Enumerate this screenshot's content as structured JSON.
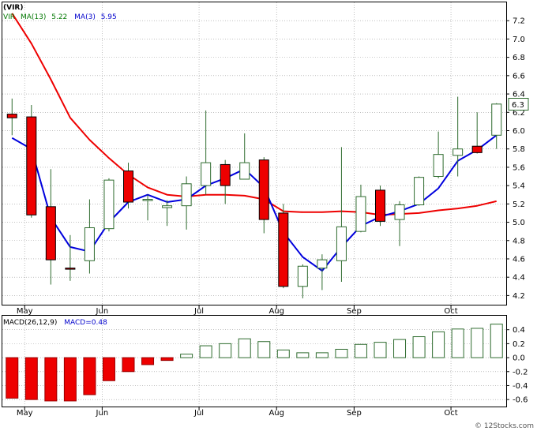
{
  "title": "(VIR)",
  "watermark": "© 12Stocks.com",
  "chart_data": [
    {
      "type": "candlestick",
      "legend": {
        "symbol": "VIR",
        "ma13_label": "MA(13)",
        "ma13_value": "5.22",
        "ma3_label": "MA(3)",
        "ma3_value": "5.95"
      },
      "y_ticks": [
        "4.2",
        "4.4",
        "4.6",
        "4.8",
        "5.0",
        "5.2",
        "5.4",
        "5.6",
        "5.8",
        "6.0",
        "6.2",
        "6.4",
        "6.6",
        "6.8",
        "7.0",
        "7.2"
      ],
      "ylim": [
        4.1,
        7.4
      ],
      "months": [
        "May",
        "Jun",
        "Jul",
        "Aug",
        "Sep",
        "Oct"
      ],
      "month_index": [
        1,
        5,
        10,
        14,
        18,
        23
      ],
      "last_price": "6.3",
      "candles": [
        {
          "o": 6.18,
          "h": 6.35,
          "l": 5.95,
          "c": 6.14
        },
        {
          "o": 6.15,
          "h": 6.28,
          "l": 5.05,
          "c": 5.08
        },
        {
          "o": 5.17,
          "h": 5.58,
          "l": 4.32,
          "c": 4.59
        },
        {
          "o": 4.5,
          "h": 4.86,
          "l": 4.36,
          "c": 4.49
        },
        {
          "o": 4.58,
          "h": 5.25,
          "l": 4.44,
          "c": 4.94
        },
        {
          "o": 4.93,
          "h": 5.48,
          "l": 4.9,
          "c": 5.46
        },
        {
          "o": 5.56,
          "h": 5.65,
          "l": 5.15,
          "c": 5.22
        },
        {
          "o": 5.24,
          "h": 5.3,
          "l": 5.02,
          "c": 5.25
        },
        {
          "o": 5.16,
          "h": 5.24,
          "l": 4.96,
          "c": 5.18
        },
        {
          "o": 5.18,
          "h": 5.5,
          "l": 4.92,
          "c": 5.42
        },
        {
          "o": 5.4,
          "h": 6.22,
          "l": 5.3,
          "c": 5.65
        },
        {
          "o": 5.63,
          "h": 5.68,
          "l": 5.2,
          "c": 5.4
        },
        {
          "o": 5.47,
          "h": 5.97,
          "l": 5.47,
          "c": 5.65
        },
        {
          "o": 5.68,
          "h": 5.71,
          "l": 4.88,
          "c": 5.03
        },
        {
          "o": 5.1,
          "h": 5.2,
          "l": 4.28,
          "c": 4.3
        },
        {
          "o": 4.3,
          "h": 4.54,
          "l": 4.17,
          "c": 4.52
        },
        {
          "o": 4.5,
          "h": 4.65,
          "l": 4.26,
          "c": 4.59
        },
        {
          "o": 4.58,
          "h": 5.82,
          "l": 4.35,
          "c": 4.95
        },
        {
          "o": 4.9,
          "h": 5.41,
          "l": 4.89,
          "c": 5.28
        },
        {
          "o": 5.35,
          "h": 5.4,
          "l": 4.96,
          "c": 5.01
        },
        {
          "o": 5.03,
          "h": 5.23,
          "l": 4.74,
          "c": 5.19
        },
        {
          "o": 5.19,
          "h": 5.5,
          "l": 5.18,
          "c": 5.49
        },
        {
          "o": 5.5,
          "h": 5.99,
          "l": 5.48,
          "c": 5.74
        },
        {
          "o": 5.73,
          "h": 6.37,
          "l": 5.5,
          "c": 5.8
        },
        {
          "o": 5.83,
          "h": 6.2,
          "l": 5.75,
          "c": 5.76
        },
        {
          "o": 5.95,
          "h": 6.3,
          "l": 5.8,
          "c": 6.29
        }
      ],
      "ma13": [
        7.28,
        6.95,
        6.56,
        6.14,
        5.9,
        5.7,
        5.52,
        5.38,
        5.3,
        5.28,
        5.3,
        5.3,
        5.29,
        5.25,
        5.12,
        5.11,
        5.11,
        5.12,
        5.11,
        5.08,
        5.09,
        5.1,
        5.13,
        5.15,
        5.18,
        5.23
      ],
      "ma3": [
        5.92,
        5.8,
        5.05,
        4.73,
        4.68,
        5.0,
        5.22,
        5.3,
        5.22,
        5.25,
        5.4,
        5.48,
        5.58,
        5.38,
        4.89,
        4.62,
        4.47,
        4.73,
        4.96,
        5.06,
        5.12,
        5.2,
        5.37,
        5.67,
        5.79,
        5.95
      ]
    },
    {
      "type": "bar",
      "legend": {
        "label": "MACD(26,12,9)",
        "value_label": "MACD=0.48"
      },
      "y_ticks": [
        "0.4",
        "0.2",
        "0.0",
        "-0.2",
        "-0.4",
        "-0.6"
      ],
      "ylim": [
        -0.7,
        0.6
      ],
      "values": [
        -0.58,
        -0.6,
        -0.62,
        -0.62,
        -0.53,
        -0.33,
        -0.2,
        -0.1,
        -0.04,
        0.05,
        0.17,
        0.2,
        0.27,
        0.23,
        0.11,
        0.07,
        0.07,
        0.12,
        0.19,
        0.22,
        0.26,
        0.3,
        0.37,
        0.41,
        0.42,
        0.48
      ],
      "colors": {
        "positive": "#2e6b2e",
        "negative": "#ee0000"
      }
    }
  ],
  "colors": {
    "bull_stroke": "#2e6b2e",
    "bear_fill": "#ee0000",
    "ma13": "#ee0000",
    "ma3": "#0000dd",
    "grid": "#999999",
    "label_green": "#007700",
    "label_blue": "#0000cc"
  }
}
